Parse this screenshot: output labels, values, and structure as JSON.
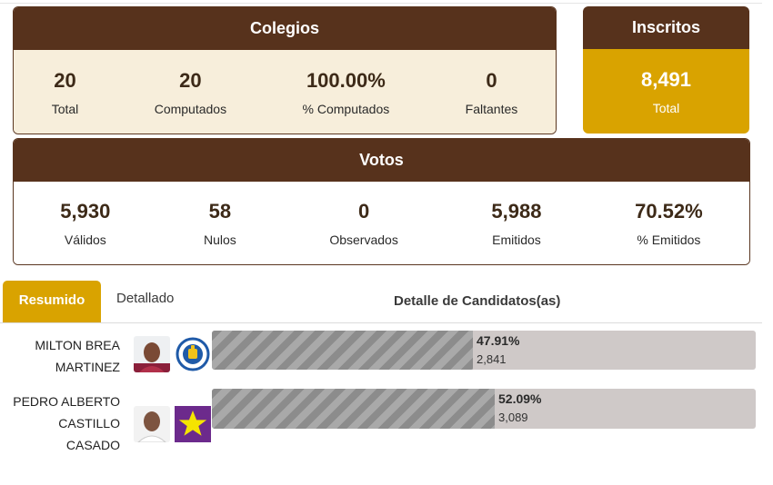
{
  "colegios": {
    "title": "Colegios",
    "stats": [
      {
        "value": "20",
        "label": "Total"
      },
      {
        "value": "20",
        "label": "Computados"
      },
      {
        "value": "100.00%",
        "label": "% Computados"
      },
      {
        "value": "0",
        "label": "Faltantes"
      }
    ]
  },
  "inscritos": {
    "title": "Inscritos",
    "value": "8,491",
    "label": "Total"
  },
  "votos": {
    "title": "Votos",
    "stats": [
      {
        "value": "5,930",
        "label": "Válidos"
      },
      {
        "value": "58",
        "label": "Nulos"
      },
      {
        "value": "0",
        "label": "Observados"
      },
      {
        "value": "5,988",
        "label": "Emitidos"
      },
      {
        "value": "70.52%",
        "label": "% Emitidos"
      }
    ]
  },
  "tabs": {
    "resumido": "Resumido",
    "detallado": "Detallado",
    "detail_title": "Detalle de Candidatos(as)"
  },
  "colors": {
    "brown": "#57321c",
    "gold": "#d9a300",
    "cream": "#f7eedb",
    "bar_track": "#cfc9c8"
  },
  "candidates": [
    {
      "name_lines": [
        "MILTON BREA",
        "MARTINEZ"
      ],
      "percent_text": "47.91%",
      "percent": 47.91,
      "votes": "2,841",
      "party_icon": "prm-party-logo-icon"
    },
    {
      "name_lines": [
        "PEDRO ALBERTO",
        "CASTILLO",
        "CASADO"
      ],
      "percent_text": "52.09%",
      "percent": 52.09,
      "votes": "3,089",
      "party_icon": "star-party-logo-icon"
    }
  ]
}
